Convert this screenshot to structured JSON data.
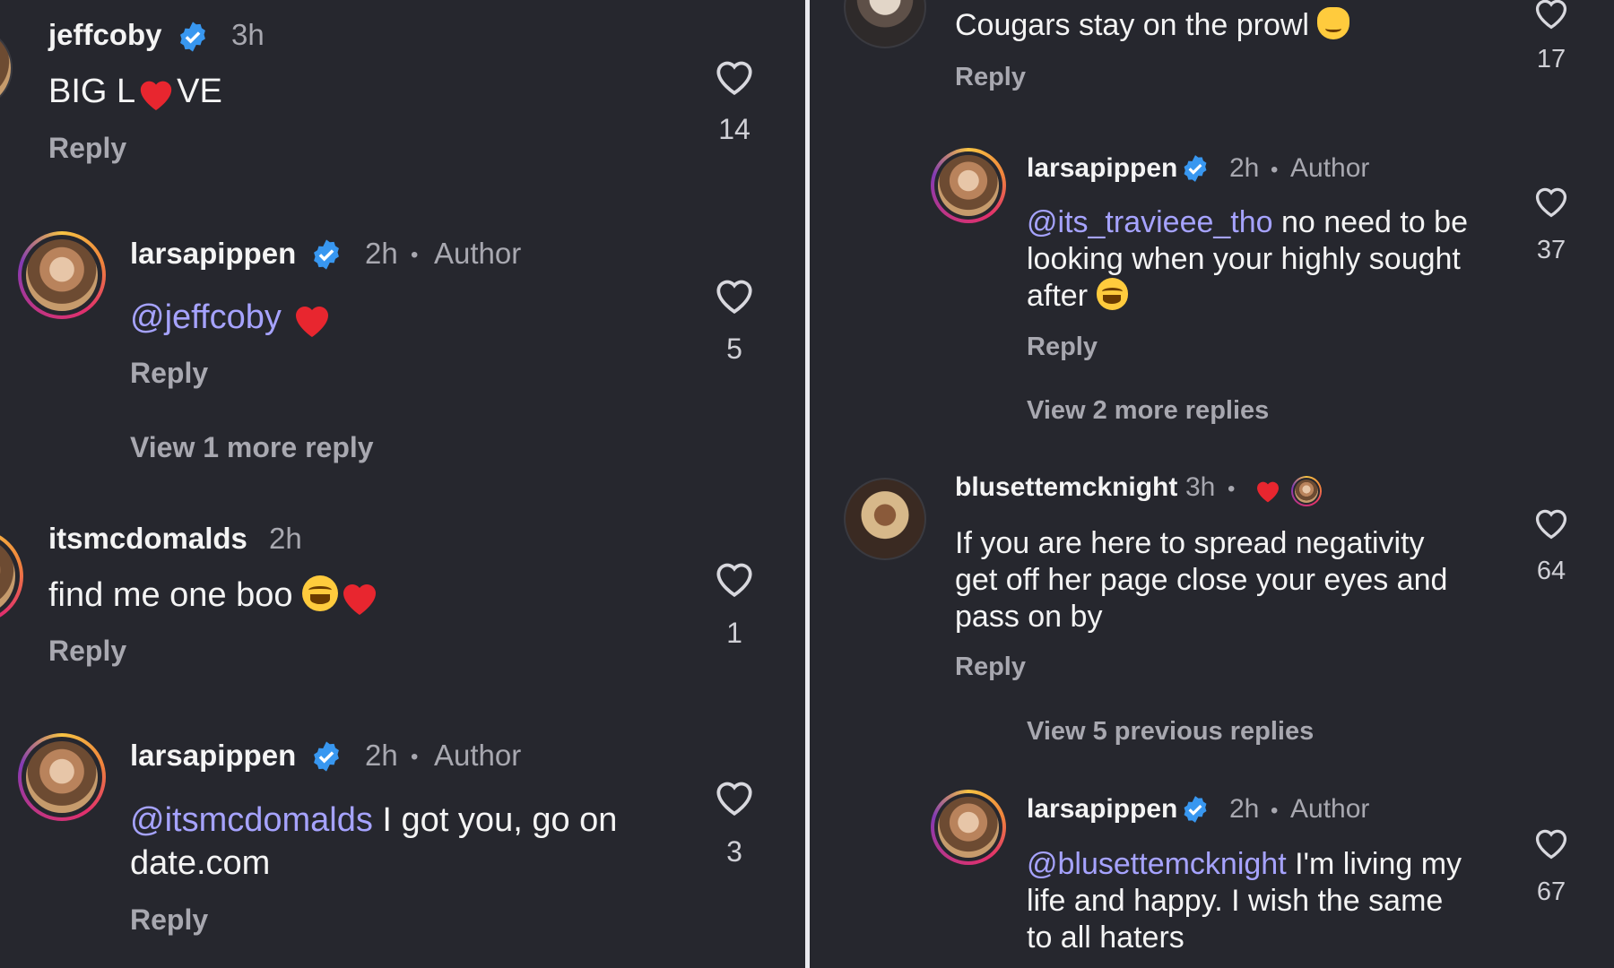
{
  "left": {
    "comments": [
      {
        "username": "jeffcoby",
        "verified": true,
        "time": "3h",
        "text_parts": [
          "BIG L",
          "VE"
        ],
        "reply": "Reply",
        "likes": "14"
      },
      {
        "username": "larsapippen",
        "verified": true,
        "time": "2h",
        "dot": "•",
        "role": "Author",
        "mention": "@jeffcoby",
        "reply": "Reply",
        "likes": "5",
        "view_more": "View 1 more reply"
      },
      {
        "username": "itsmcdomalds",
        "verified": false,
        "time": "2h",
        "text": "find me one boo",
        "reply": "Reply",
        "likes": "1"
      },
      {
        "username": "larsapippen",
        "verified": true,
        "time": "2h",
        "dot": "•",
        "role": "Author",
        "mention": "@itsmcdomalds",
        "text_line1": " I got you, go on",
        "text_line2": "date.com",
        "reply": "Reply",
        "likes": "3"
      }
    ]
  },
  "right": {
    "comments": [
      {
        "text": "Cougars stay on the prowl",
        "reply": "Reply",
        "likes": "17"
      },
      {
        "username": "larsapippen",
        "verified": true,
        "time": "2h",
        "dot": "•",
        "role": "Author",
        "mention": "@its_travieee_tho",
        "text_line1": " no need to be",
        "text_line2": "looking when your highly sought",
        "text_line3": "after",
        "reply": "Reply",
        "likes": "37",
        "view_more": "View 2 more replies"
      },
      {
        "username": "blusettemcknight",
        "time": "3h",
        "dot": "•",
        "text_line1": "If you are here to spread negativity",
        "text_line2": "get off her page close your eyes and",
        "text_line3": "pass on by",
        "reply": "Reply",
        "likes": "64",
        "view_previous": "View 5 previous replies"
      },
      {
        "username": "larsapippen",
        "verified": true,
        "time": "2h",
        "dot": "•",
        "role": "Author",
        "mention": "@blusettemcknight",
        "text_line1": " I'm living my",
        "text_line2": "life and happy. I wish the same",
        "text_line3": "to all haters",
        "likes": "67"
      }
    ]
  },
  "colors": {
    "background": "#26272e",
    "mention": "#a6a3ff",
    "verified": "#3897f0",
    "heart_emoji": "#e8262f",
    "muted": "#a8a8b0"
  },
  "icons": [
    "verified-badge-icon",
    "heart-outline-icon",
    "red-heart-emoji",
    "laughing-emoji",
    "cat-emoji"
  ]
}
